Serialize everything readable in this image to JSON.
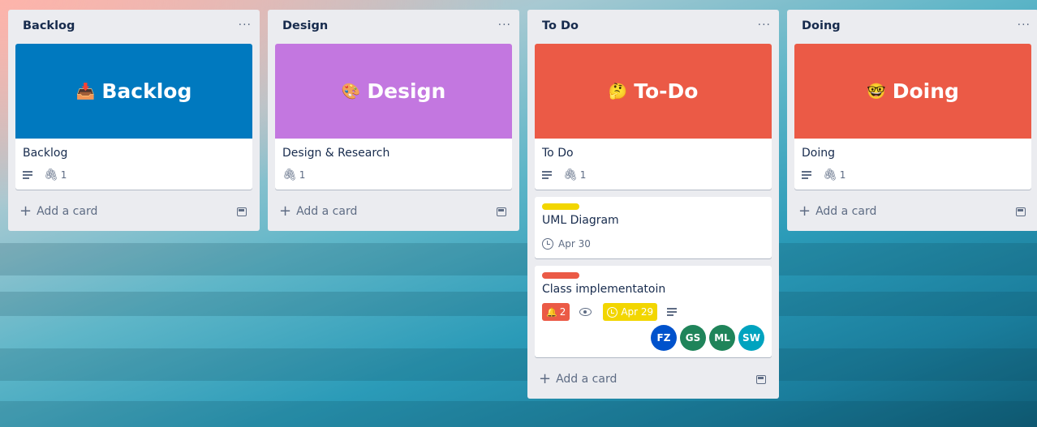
{
  "lists": [
    {
      "title": "Backlog",
      "menu": "···",
      "cover": {
        "emoji": "📥",
        "text": "Backlog",
        "color": "#0079bf"
      },
      "card_title": "Backlog",
      "attachments": "1",
      "add_card": "Add a card"
    },
    {
      "title": "Design",
      "menu": "···",
      "cover": {
        "emoji": "🎨",
        "text": "Design",
        "color": "#c377e0"
      },
      "card_title": "Design & Research",
      "attachments": "1",
      "add_card": "Add a card"
    },
    {
      "title": "To Do",
      "menu": "···",
      "cover": {
        "emoji": "🤔",
        "text": "To-Do",
        "color": "#eb5a46"
      },
      "card_title": "To Do",
      "attachments": "1",
      "add_card": "Add a card"
    },
    {
      "title": "Doing",
      "menu": "···",
      "cover": {
        "emoji": "🤓",
        "text": "Doing",
        "color": "#eb5a46"
      },
      "card_title": "Doing",
      "attachments": "1",
      "add_card": "Add a card"
    }
  ],
  "todo_cards": [
    {
      "label_color": "#f2d600",
      "title": "UML Diagram",
      "due": "Apr 30"
    },
    {
      "label_color": "#eb5a46",
      "title": "Class implementatoin",
      "notifications": "2",
      "due": "Apr 29",
      "members": [
        {
          "initials": "FZ",
          "color": "#0052cc"
        },
        {
          "initials": "GS",
          "color": "#1f845a"
        },
        {
          "initials": "ML",
          "color": "#1f845a"
        },
        {
          "initials": "SW",
          "color": "#00a3bf"
        }
      ]
    }
  ],
  "icons": {
    "description": "description-icon",
    "attachment": "paperclip-icon",
    "clock": "clock-icon",
    "bell": "bell-icon",
    "eye": "eye-icon",
    "plus": "plus-icon",
    "template": "card-template-icon"
  },
  "glyphs": {
    "clip": "🖇",
    "bell": "🔔",
    "plus": "+"
  }
}
